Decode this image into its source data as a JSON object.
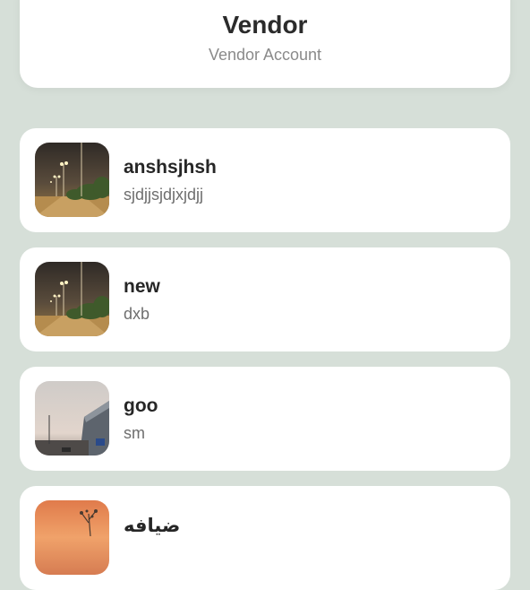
{
  "header": {
    "title": "Vendor",
    "subtitle": "Vendor Account"
  },
  "vendors": [
    {
      "name": "anshsjhsh",
      "description": "sjdjjsjdjxjdjj",
      "image": "night-street-palm-trees-image"
    },
    {
      "name": "new",
      "description": "dxb",
      "image": "night-street-palm-trees-image"
    },
    {
      "name": "goo",
      "description": "sm",
      "image": "bridge-sky-image"
    },
    {
      "name": "ضيافه",
      "description": "",
      "image": "sunset-image"
    }
  ],
  "colors": {
    "background": "#d6dfd8",
    "card": "#ffffff",
    "title": "#2b2b2b",
    "subtitle": "#8a8a8a"
  }
}
